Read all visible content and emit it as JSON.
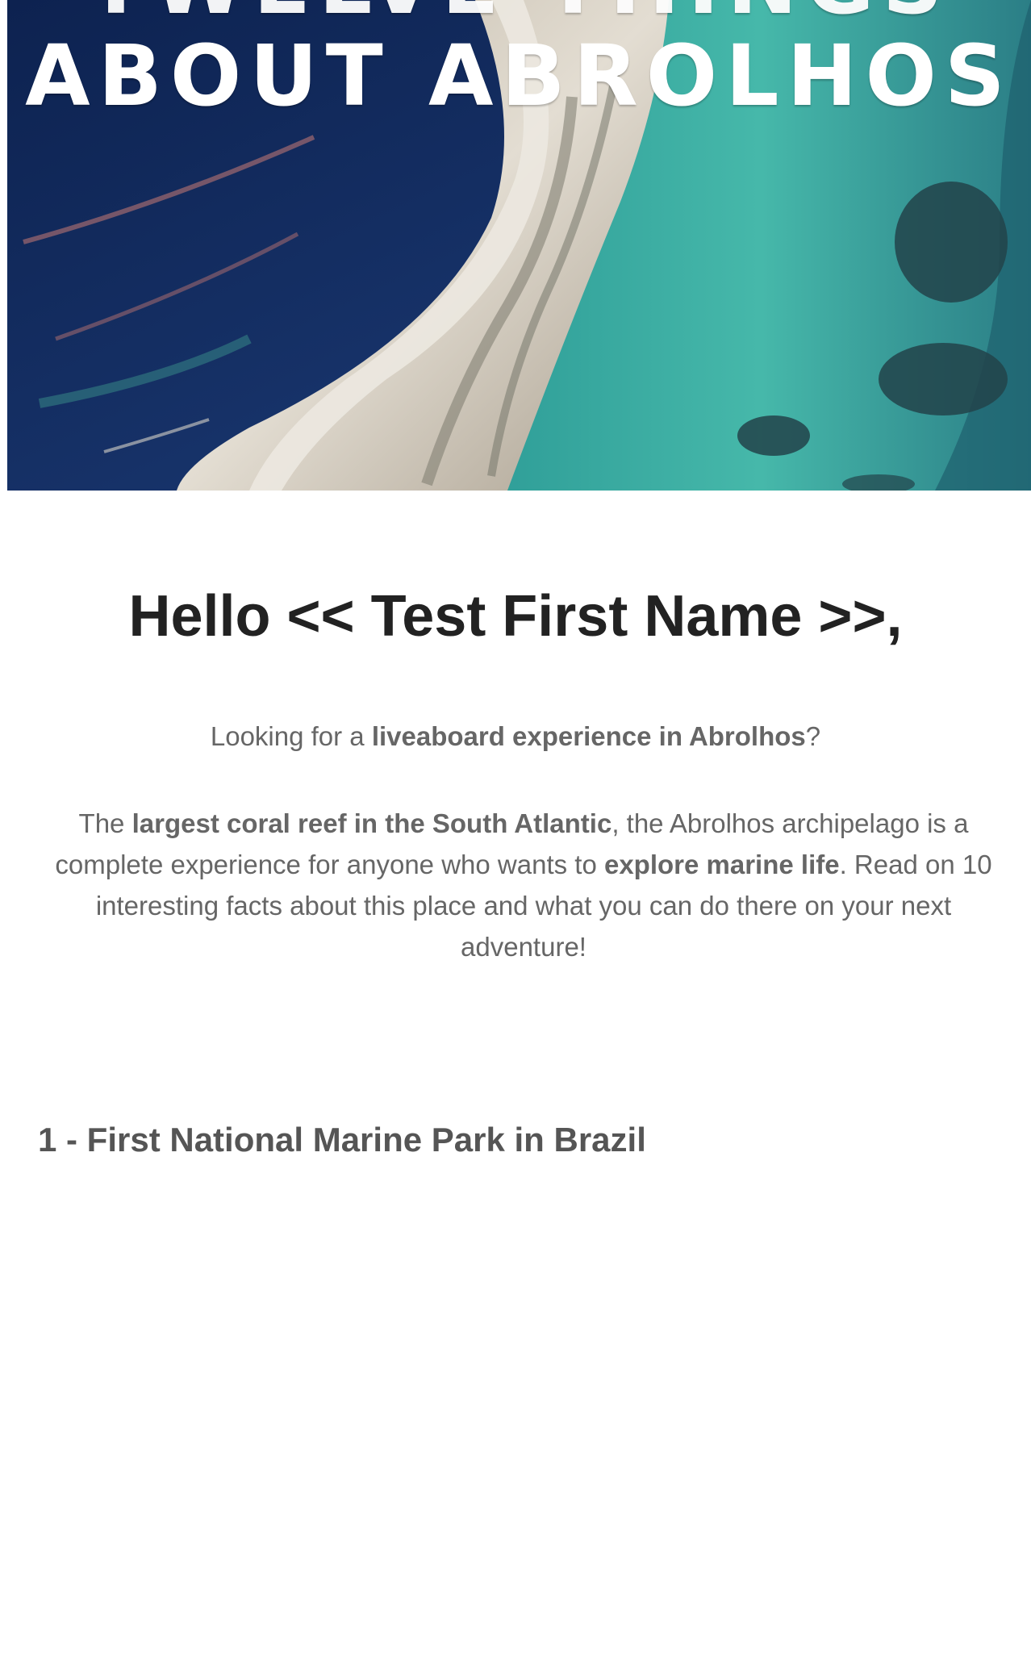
{
  "hero": {
    "title_line1": "TWELVE THINGS",
    "title_line2": "ABOUT ABROLHOS",
    "colors": {
      "deep_water": "#10264f",
      "reef_water": "#3fb3a6",
      "sand": "#d9d3c8"
    }
  },
  "greeting": {
    "text": "Hello << Test First Name >>,"
  },
  "intro": {
    "prefix": "Looking for a ",
    "bold": "liveaboard experience in Abrolhos",
    "suffix": "?"
  },
  "body_paragraph": {
    "part1": "The ",
    "bold1": "largest coral reef in the South Atlantic",
    "part2": ", the Abrolhos archipelago is a complete experience for anyone who wants to ",
    "bold2": "explore marine life",
    "part3": ". Read on 10 interesting facts about this place and what you can do there on your next adventure!"
  },
  "section": {
    "heading": "1 - First National Marine Park in Brazil"
  }
}
